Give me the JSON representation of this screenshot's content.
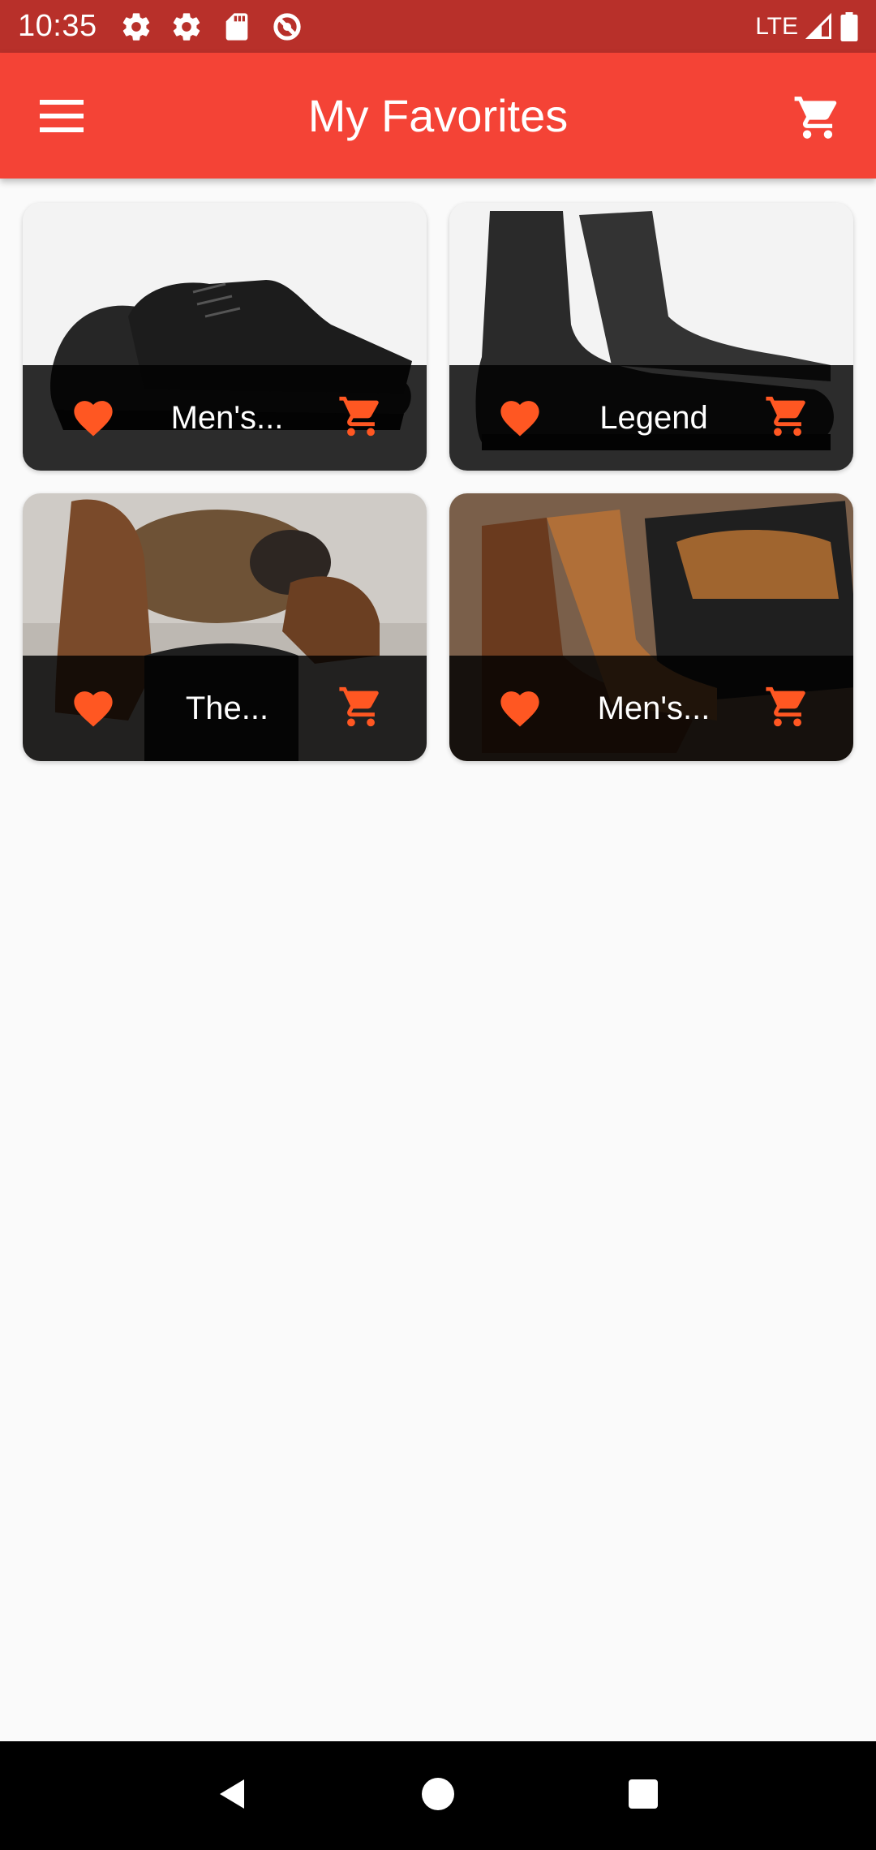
{
  "status": {
    "time": "10:35",
    "network": "LTE",
    "icons": [
      "settings-icon",
      "settings-icon",
      "sd-card-icon",
      "do-not-disturb-icon",
      "signal-icon",
      "battery-icon"
    ]
  },
  "app_bar": {
    "title": "My Favorites",
    "menu_icon": "menu-icon",
    "cart_icon": "shopping-cart-icon"
  },
  "products": [
    {
      "title": "Men's...",
      "image": "black-sneakers"
    },
    {
      "title": "Legend",
      "image": "black-chelsea-boots"
    },
    {
      "title": "The...",
      "image": "brown-boots-with-dog"
    },
    {
      "title": "Men's...",
      "image": "brown-chelsea-boots"
    }
  ],
  "colors": {
    "primary": "#f44336",
    "status_bar": "#b8302a",
    "accent": "#ff5722",
    "background": "#fafafa"
  },
  "nav": [
    "back-icon",
    "home-icon",
    "recents-icon"
  ]
}
